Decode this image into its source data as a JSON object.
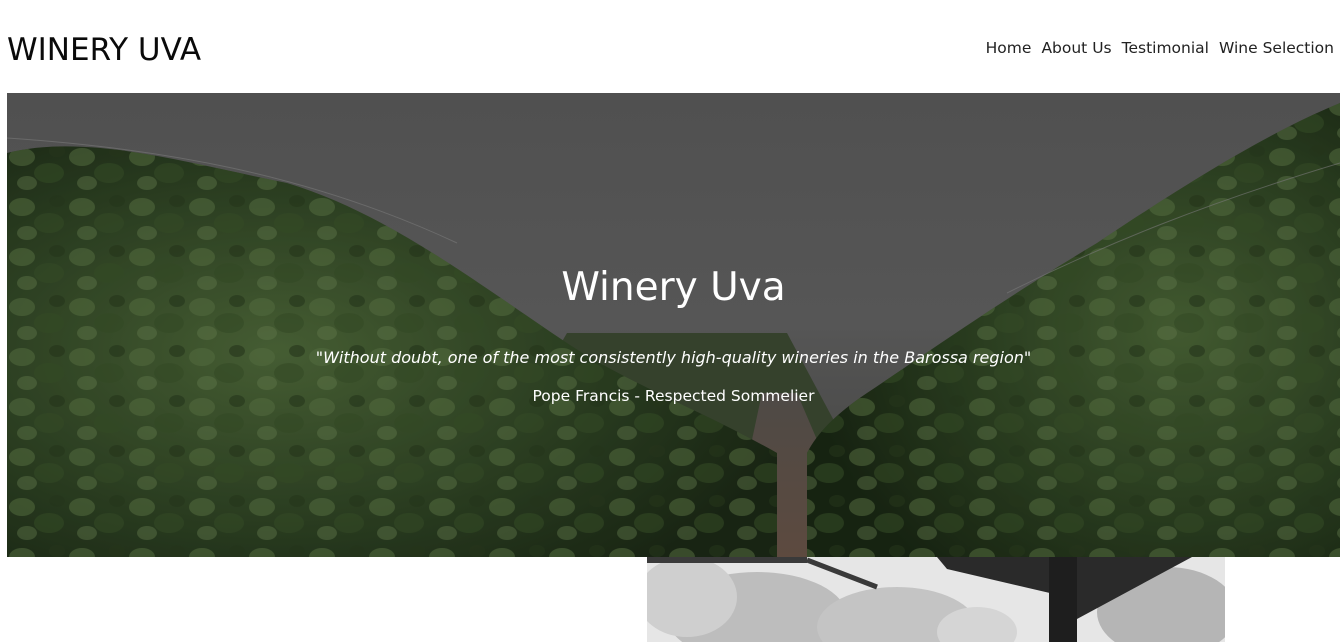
{
  "header": {
    "logo": "WINERY UVA",
    "nav": [
      {
        "label": "Home"
      },
      {
        "label": "About Us"
      },
      {
        "label": "Testimonial"
      },
      {
        "label": "Wine Selection"
      }
    ]
  },
  "hero": {
    "title": "Winery Uva",
    "quote": "\"Without doubt, one of the most consistently high-quality wineries in the Barossa region\"",
    "author": "Pope Francis - Respected Sommelier",
    "image": "vineyard-rows-photo",
    "overlay_color": "#5e5e5e"
  },
  "section_image": "black-and-white-pergola-trees-photo"
}
